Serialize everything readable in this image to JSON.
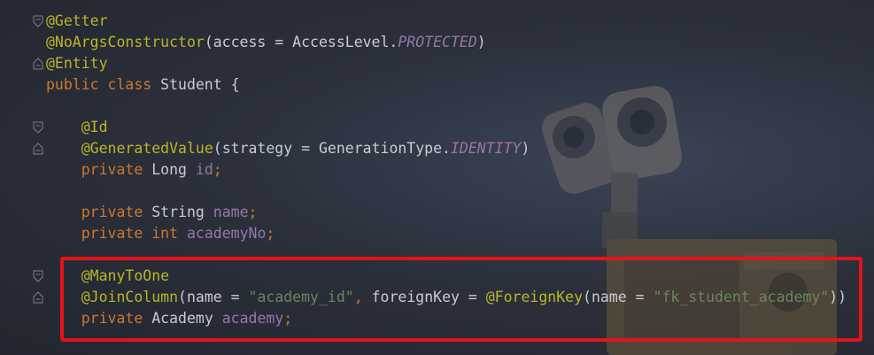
{
  "editor": {
    "accent_color": "#e2141a",
    "lines": [
      {
        "indent": "",
        "tokens": [
          {
            "t": "@Getter",
            "c": "ann"
          }
        ]
      },
      {
        "indent": "",
        "tokens": [
          {
            "t": "@NoArgsConstructor",
            "c": "ann"
          },
          {
            "t": "(access = AccessLevel.",
            "c": "pl"
          },
          {
            "t": "PROTECTED",
            "c": "const"
          },
          {
            "t": ")",
            "c": "pl"
          }
        ]
      },
      {
        "indent": "",
        "tokens": [
          {
            "t": "@Entity",
            "c": "ann"
          }
        ]
      },
      {
        "indent": "",
        "tokens": [
          {
            "t": "public class ",
            "c": "kw"
          },
          {
            "t": "Student {",
            "c": "pl"
          }
        ]
      },
      {
        "indent": "",
        "tokens": []
      },
      {
        "indent": "    ",
        "tokens": [
          {
            "t": "@Id",
            "c": "ann"
          }
        ]
      },
      {
        "indent": "    ",
        "tokens": [
          {
            "t": "@GeneratedValue",
            "c": "ann"
          },
          {
            "t": "(strategy = GenerationType.",
            "c": "pl"
          },
          {
            "t": "IDENTITY",
            "c": "const"
          },
          {
            "t": ")",
            "c": "pl"
          }
        ]
      },
      {
        "indent": "    ",
        "tokens": [
          {
            "t": "private ",
            "c": "kw"
          },
          {
            "t": "Long ",
            "c": "pl"
          },
          {
            "t": "id",
            "c": "field"
          },
          {
            "t": ";",
            "c": "kw"
          }
        ]
      },
      {
        "indent": "",
        "tokens": []
      },
      {
        "indent": "    ",
        "tokens": [
          {
            "t": "private ",
            "c": "kw"
          },
          {
            "t": "String ",
            "c": "pl"
          },
          {
            "t": "name",
            "c": "field"
          },
          {
            "t": ";",
            "c": "kw"
          }
        ]
      },
      {
        "indent": "    ",
        "tokens": [
          {
            "t": "private int ",
            "c": "kw"
          },
          {
            "t": "academyNo",
            "c": "field"
          },
          {
            "t": ";",
            "c": "kw"
          }
        ]
      },
      {
        "indent": "",
        "tokens": []
      },
      {
        "indent": "    ",
        "tokens": [
          {
            "t": "@ManyToOne",
            "c": "ann"
          }
        ]
      },
      {
        "indent": "    ",
        "tokens": [
          {
            "t": "@JoinColumn",
            "c": "ann"
          },
          {
            "t": "(name = ",
            "c": "pl"
          },
          {
            "t": "\"academy_id\"",
            "c": "str"
          },
          {
            "t": ", ",
            "c": "kw"
          },
          {
            "t": "foreignKey = ",
            "c": "pl"
          },
          {
            "t": "@ForeignKey",
            "c": "ann"
          },
          {
            "t": "(name = ",
            "c": "pl"
          },
          {
            "t": "\"fk_student_academy\"",
            "c": "str"
          },
          {
            "t": "))",
            "c": "pl"
          }
        ]
      },
      {
        "indent": "    ",
        "tokens": [
          {
            "t": "private ",
            "c": "kw"
          },
          {
            "t": "Academy ",
            "c": "pl"
          },
          {
            "t": "academy",
            "c": "field"
          },
          {
            "t": ";",
            "c": "kw"
          }
        ]
      }
    ],
    "fold_markers": [
      {
        "line": 0,
        "icon": "fold-start-icon"
      },
      {
        "line": 2,
        "icon": "fold-end-icon"
      },
      {
        "line": 5,
        "icon": "fold-start-icon"
      },
      {
        "line": 6,
        "icon": "fold-end-icon"
      },
      {
        "line": 12,
        "icon": "fold-start-icon"
      },
      {
        "line": 13,
        "icon": "fold-end-icon"
      }
    ]
  }
}
